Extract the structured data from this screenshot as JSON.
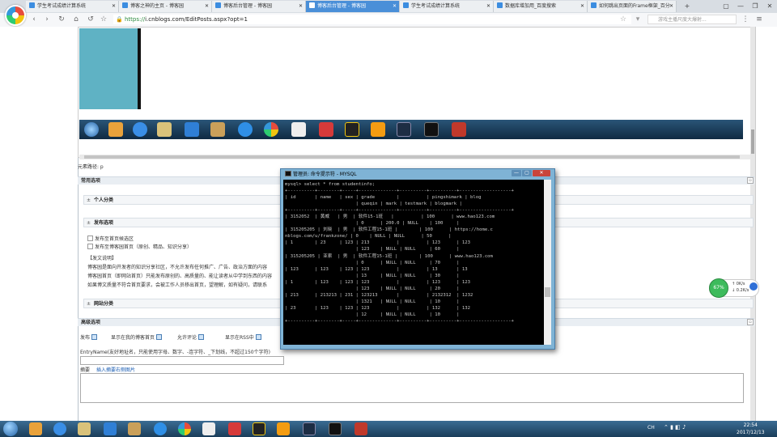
{
  "browser": {
    "tabs": [
      {
        "label": "学生考试成绩计算系统",
        "active": false
      },
      {
        "label": "博客之神的主页 - 博客园",
        "active": false
      },
      {
        "label": "博客后台管理 - 博客园",
        "active": false
      },
      {
        "label": "博客后台管理 - 博客园",
        "active": true
      },
      {
        "label": "学生考试成绩计算系统",
        "active": false
      },
      {
        "label": "数据库增加用_百度搜索",
        "active": false
      },
      {
        "label": "如何跳出页面的Frame框架_百分",
        "active": false
      }
    ],
    "new_tab": "+",
    "url_scheme": "https://",
    "url_rest": "i.cnblogs.com/EditPosts.aspx?opt=1",
    "search_placeholder": "游戏主播尺度大爆射...",
    "window_controls": [
      "▢",
      "—",
      "❐",
      "✕"
    ]
  },
  "page": {
    "element_path": "元素路径: p",
    "sections": {
      "common": "常用选项",
      "personal_category": "个人分类",
      "publish_options": "发布选项",
      "website_category": "网站分类",
      "advanced": "高级选项"
    },
    "publish": {
      "candidate": "发布至首页候选区",
      "homepage": "发布至博客园首页（原创、精品、知识分享）",
      "notice_title": "【发文说明】",
      "notice_lines": [
        "博客园是面向开发者的知识分享社区，不允许发布任何推广、广告、政治方面的内容",
        "博客园首页（即网站首页）只能发布原创的、高质量的、能让读者从中学到东西的内容",
        "如果博文质量不符合首页要求，会被工作人员移出首页，望理解，如有疑问，请联系"
      ]
    },
    "advanced": {
      "publish_label": "发布",
      "show_in_mine": "显示在我的博客首页",
      "allow_comment": "允许评论",
      "show_rss": "显示在RSS中",
      "entryname_hint": "EntryName(友好地址名，只能使用字母、数字、-连字符、_下划线，不超过150个字符)",
      "summary_label": "摘要",
      "insert_image": "插入摘要右侧图片"
    }
  },
  "cmd": {
    "title": "管理员: 命令提示符 - MYSQL",
    "lines": [
      "mysql> select * from studentinfo;",
      "+----------+--------+-----+--------------+----------+----------+-------------------+",
      "| id       | name   | sex | grade        |          | pingshimark | blog",
      "                          | queqin | mark | testmark | blogmark |",
      "+----------+--------+-----+--------------+----------+----------+-------------------+",
      "| 3152052  | 黄威   | 男  | 软件15-1班   |          | 100      | www.hao123.com",
      "                          | 0      | 200.0 | NULL    | 100     |",
      "| 315205205 | 刘晓  | 男  | 软件工程15-1班 |        | 100      | https://home.c",
      "nblogs.com/u/frankzone/ | 0    | NULL | NULL      | 50      |",
      "| 1        | 23     | 123 | 213          |          | 123      | 123",
      "                          | 123    | NULL | NULL     | 60      |",
      "| 315205205 | 亚索  | 男  | 软件工程15-1班 |        | 100      | www.hao123.com",
      "                          | 0      | NULL | NULL     | 70      |",
      "| 123      | 123    | 123 | 123          |          | 13       | 13",
      "                          | 13     | NULL | NULL     | 30      |",
      "| 1        | 123    | 123 | 123          |          | 123      | 123",
      "                          | 123    | NULL | NULL     | 20      |",
      "| 213      | 213213 | 231 | 123213       |          | 2132312  | 1232",
      "                          | 1321   | NULL | NULL     | 10      |",
      "| 23       | 123    | 123 | 123          |          | 132      | 132",
      "                          | 12     | NULL | NULL     | 10      |",
      "+----------+--------+-----+--------------+----------+----------+-------------------+"
    ]
  },
  "widget": {
    "percent": "67%",
    "speed_up": "0K/s",
    "speed_down": "0.2K/s"
  },
  "taskbar": {
    "ime": "CH",
    "time": "22:54",
    "date": "2017/12/13"
  },
  "colors": {
    "active_tab": "#4a8fd8",
    "url_green": "#2b8a3e",
    "cmd_bg": "#000000",
    "taskbar": "#1a3d5a"
  }
}
